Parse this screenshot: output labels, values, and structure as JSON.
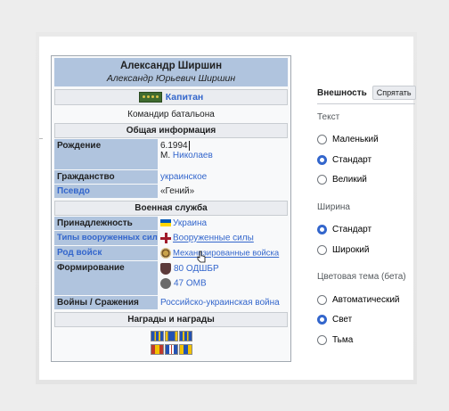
{
  "infobox": {
    "name": "Александр Ширшин",
    "full_name": "Александр Юрьевич Ширшин",
    "rank": "Капитан",
    "position": "Командир батальона",
    "sections": {
      "general": "Общая информация",
      "military": "Военная служба",
      "awards": "Награды и награды"
    },
    "rows": {
      "birth_label": "Рождение",
      "birth_date": "6.1994",
      "birth_place_prefix": "М.",
      "birth_place": "Николаев",
      "citizenship_label": "Гражданство",
      "citizenship": "украинское",
      "alias_label": "Псевдо",
      "alias": "«Гений»",
      "affiliation_label": "Принадлежность",
      "affiliation": "Украина",
      "armed_forces_label": "Типы вооруженных сил",
      "armed_forces": "Вооруженные силы",
      "branch_label": "Род войск",
      "branch": "Механизированные войска",
      "formation_label": "Формирование",
      "formation_1": "80 ОДШБР",
      "formation_2": "47 ОМВ",
      "wars_label": "Войны / Сражения",
      "wars": "Российско-украинская война"
    }
  },
  "panel": {
    "title": "Внешность",
    "hide_button": "Спрятать",
    "text_group": "Текст",
    "text_options": [
      "Маленький",
      "Стандарт",
      "Великий"
    ],
    "width_group": "Ширина",
    "width_options": [
      "Стандарт",
      "Широкий"
    ],
    "theme_group": "Цветовая тема (бета)",
    "theme_options": [
      "Автоматический",
      "Свет",
      "Тьма"
    ],
    "selected": {
      "text": "Стандарт",
      "width": "Стандарт",
      "theme": "Свет"
    }
  },
  "colors": {
    "link": "#3366cc",
    "header_bg": "#b0c4de",
    "radio_on": "#3366cc"
  }
}
